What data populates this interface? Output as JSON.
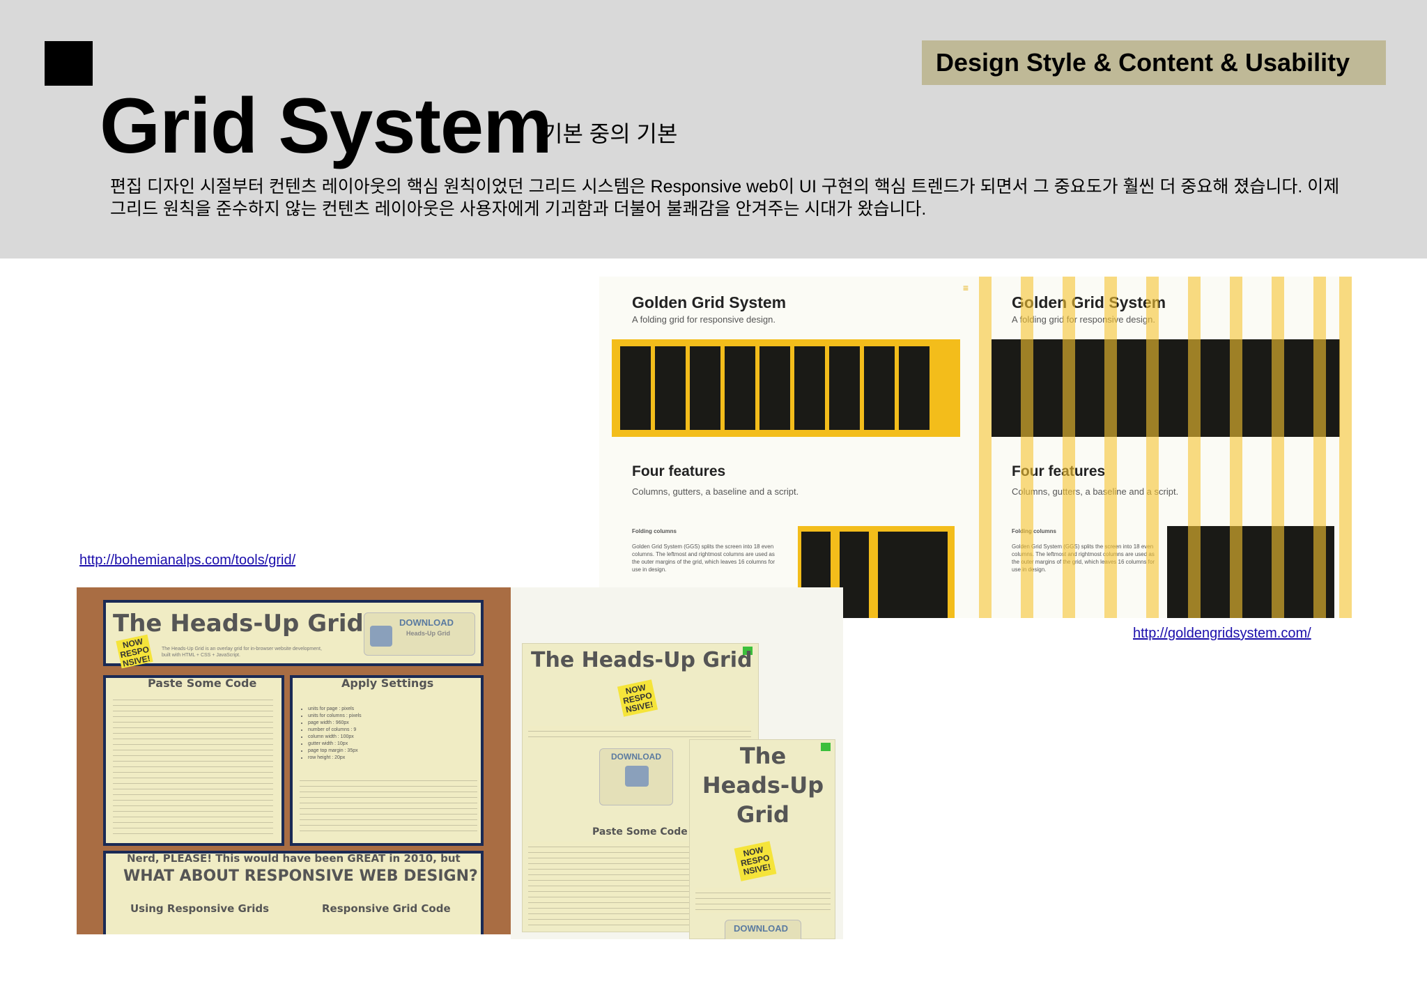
{
  "header": {
    "badge": "Design Style & Content & Usability",
    "title": "Grid System",
    "subtitle": "기본 중의 기본",
    "intro": "편집 디자인 시절부터 컨텐츠 레이아웃의 핵심 원칙이었던 그리드 시스템은 Responsive web이 UI 구현의 핵심 트렌드가 되면서 그 중요도가 훨씬 더 중요해 졌습니다. 이제 그리드 원칙을 준수하지 않는 컨텐츠 레이아웃은 사용자에게 기괴함과 더불어 불쾌감을 안겨주는 시대가 왔습니다."
  },
  "links": {
    "bohemian": "http://bohemianalps.com/tools/grid/",
    "golden": "http://goldengridsystem.com/"
  },
  "golden_grid": {
    "title": "Golden Grid System",
    "tagline": "A folding grid for responsive design.",
    "features_heading": "Four features",
    "features_text": "Columns, gutters, a baseline and a script.",
    "folding_label": "Folding columns",
    "folding_text": "Golden Grid System (GGS) splits the screen into 18 even columns. The leftmost and rightmost columns are used as the outer margins of the grid, which leaves 16 columns for use in design."
  },
  "heads_up": {
    "title": "The Heads-Up Grid",
    "sticky": "NOW RESPO NSIVE!",
    "download": "DOWNLOAD",
    "download_sub": "Heads-Up Grid",
    "intro": "The Heads-Up Grid is an overlay grid for in-browser website development, built with HTML + CSS + JavaScript.",
    "paste_heading": "Paste Some Code",
    "apply_heading": "Apply Settings",
    "settings": [
      "units for page : pixels",
      "units for columns : pixels",
      "page width : 960px",
      "number of columns : 9",
      "column width : 100px",
      "gutter width : 10px",
      "page top margin : 35px",
      "row height : 20px"
    ],
    "nerd_line": "Nerd, PLEASE! This would have been GREAT in 2010, but",
    "responsive_line": "WHAT ABOUT RESPONSIVE WEB DESIGN?",
    "using_grids": "Using Responsive Grids",
    "grid_code": "Responsive Grid Code"
  },
  "heads_up_responsive": {
    "title": "The Heads-Up Grid",
    "title_stacked": [
      "The",
      "Heads-Up",
      "Grid"
    ],
    "sticky": "NOW RESPO NSIVE!",
    "download": "DOWNLOAD",
    "paste_heading": "Paste Some Code"
  },
  "colors": {
    "header_band": "#d9d9d9",
    "badge": "#bfb997",
    "golden_yellow": "#f3bd1b",
    "grid_dark": "#1a1a16",
    "link": "#1a0dab",
    "wood": "#a96d43",
    "panel_border": "#1a2a55"
  }
}
